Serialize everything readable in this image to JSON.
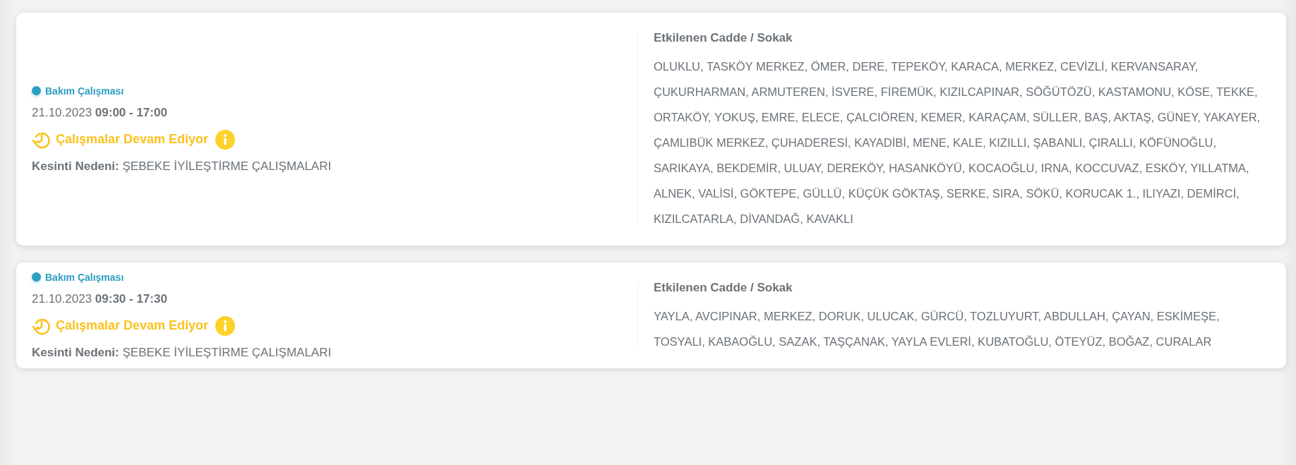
{
  "outages": [
    {
      "category": {
        "label": "Bakım Çalışması",
        "color": "#2e9ec2"
      },
      "date": "21.10.2023",
      "time": "09:00 - 17:00",
      "status": "Çalışmalar Devam Ediyor",
      "reason_label": "Kesinti Nedeni:",
      "reason": "ŞEBEKE İYİLEŞTİRME ÇALIŞMALARI",
      "streets_title": "Etkilenen Cadde / Sokak",
      "streets": "OLUKLU, TASKÖY MERKEZ, ÖMER, DERE, TEPEKÖY, KARACA, MERKEZ, CEVİZLİ, KERVANSARAY, ÇUKURHARMAN, ARMUTEREN, İSVERE, FİREMÜK, KIZILCAPINAR, SÖĞÜTÖZÜ, KASTAMONU, KÖSE, TEKKE, ORTAKÖY, YOKUŞ, EMRE, ELECE, ÇALCIÖREN, KEMER, KARAÇAM, SÜLLER, BAŞ, AKTAŞ, GÜNEY, YAKAYER, ÇAMLIBÜK MERKEZ, ÇUHADERESİ, KAYADİBİ, MENE, KALE, KIZILLI, ŞABANLI, ÇIRALLI, KÖFÜNOĞLU, SARIKAYA, BEKDEMİR, ULUAY, DEREKÖY, HASANKÖYÜ, KOCAOĞLU, IRNA, KOCCUVAZ, ESKÖY, YILLATMA, ALNEK, VALİSİ, GÖKTEPE, GÜLLÜ, KÜÇÜK GÖKTAŞ, SERKE, SIRA, SÖKÜ, KORUCAK 1., ILIYAZI, DEMİRCİ, KIZILCATARLA, DİVANDAĞ, KAVAKLI"
    },
    {
      "category": {
        "label": "Bakım Çalışması",
        "color": "#2e9ec2"
      },
      "date": "21.10.2023",
      "time": "09:30 - 17:30",
      "status": "Çalışmalar Devam Ediyor",
      "reason_label": "Kesinti Nedeni:",
      "reason": "ŞEBEKE İYİLEŞTİRME ÇALIŞMALARI",
      "streets_title": "Etkilenen Cadde / Sokak",
      "streets": "YAYLA, AVCIPINAR, MERKEZ, DORUK, ULUCAK, GÜRCÜ, TOZLUYURT, ABDULLAH, ÇAYAN, ESKİMEŞE, TOSYALI, KABAOĞLU, SAZAK, TAŞÇANAK, YAYLA EVLERİ, KUBATOĞLU, ÖTEYÜZ, BOĞAZ, CURALAR"
    }
  ]
}
